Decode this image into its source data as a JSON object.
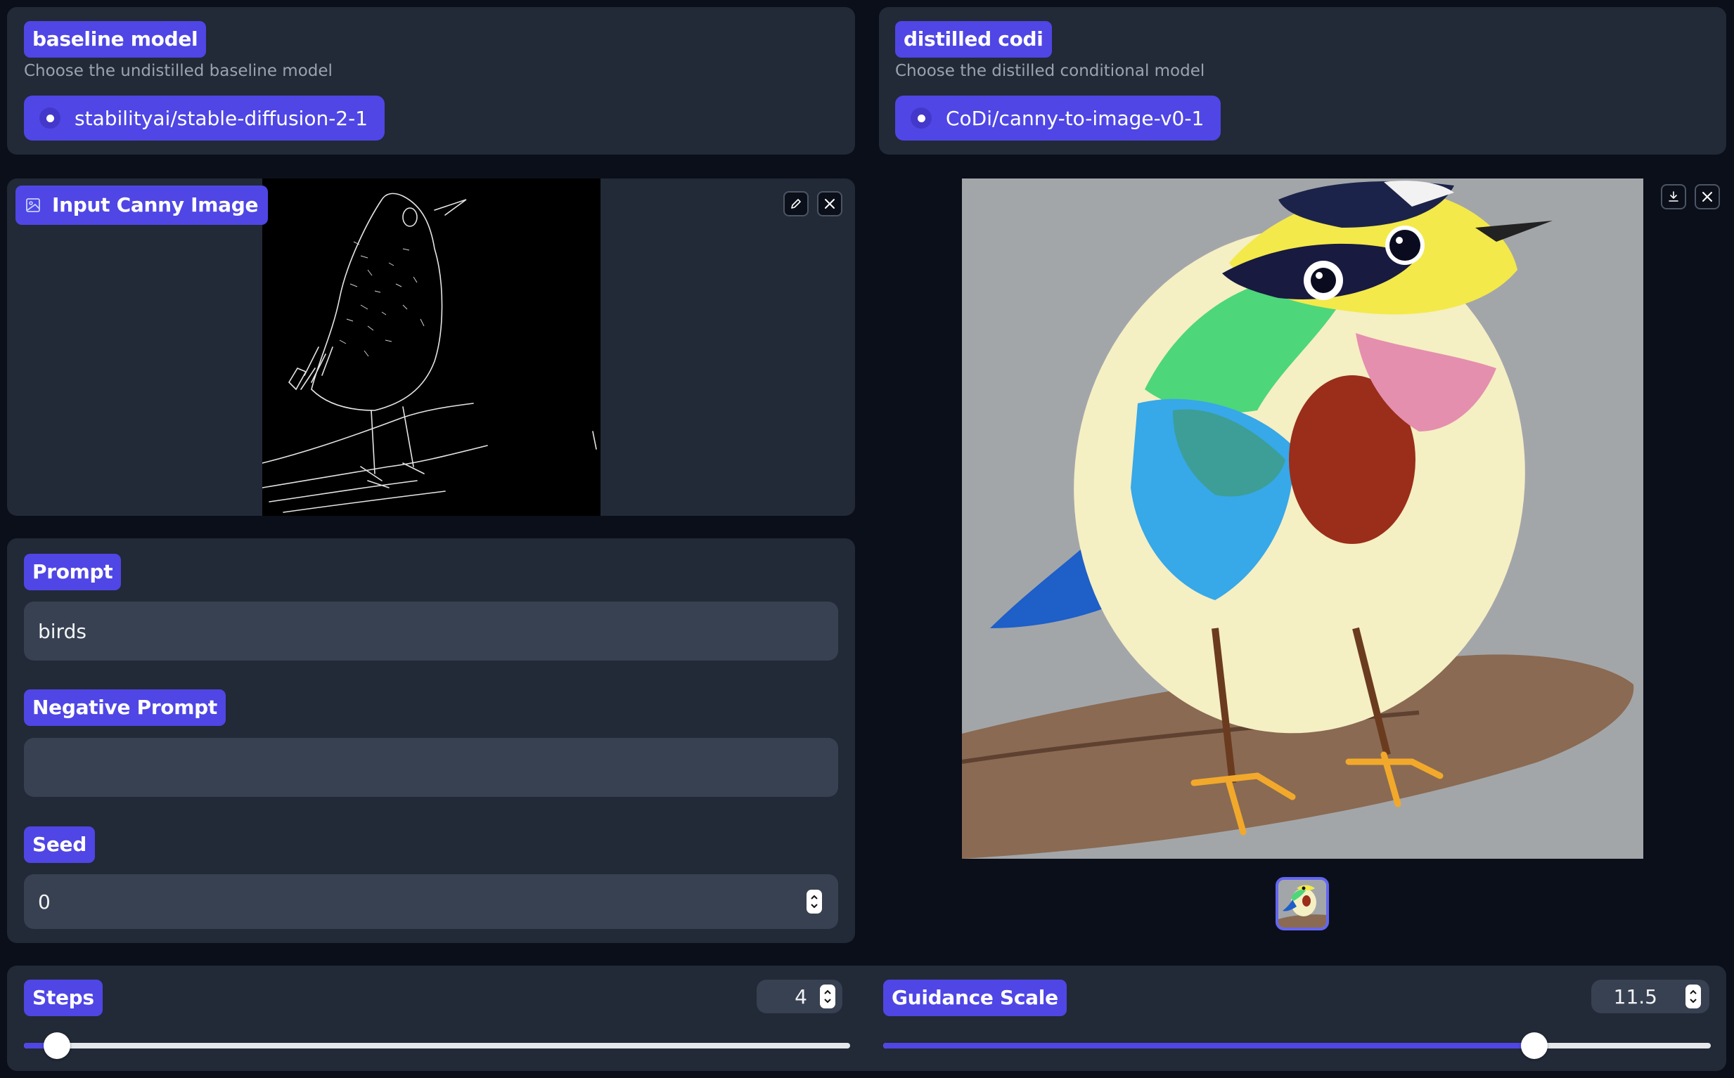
{
  "baseline": {
    "label": "baseline model",
    "info": "Choose the undistilled baseline model",
    "options": [
      {
        "label": "stabilityai/stable-diffusion-2-1",
        "selected": true
      }
    ]
  },
  "distilled": {
    "label": "distilled codi",
    "info": "Choose the distilled conditional model",
    "options": [
      {
        "label": "CoDi/canny-to-image-v0-1",
        "selected": true
      }
    ]
  },
  "input_image": {
    "label": "Input Canny Image",
    "icons": {
      "label": "image-icon",
      "edit": "pencil-icon",
      "clear": "close-icon"
    }
  },
  "prompt": {
    "label": "Prompt",
    "value": "birds"
  },
  "negative_prompt": {
    "label": "Negative Prompt",
    "value": ""
  },
  "seed": {
    "label": "Seed",
    "value": "0"
  },
  "output_image": {
    "icons": {
      "download": "download-icon",
      "clear": "close-icon"
    },
    "thumbnails": 1
  },
  "steps": {
    "label": "Steps",
    "value": "4",
    "fraction": 0.04
  },
  "guidance": {
    "label": "Guidance Scale",
    "value": "11.5",
    "fraction": 0.787
  },
  "colors": {
    "background": "#0b0f19",
    "panel": "#222937",
    "accent": "#4f46e5",
    "input": "#374151"
  }
}
